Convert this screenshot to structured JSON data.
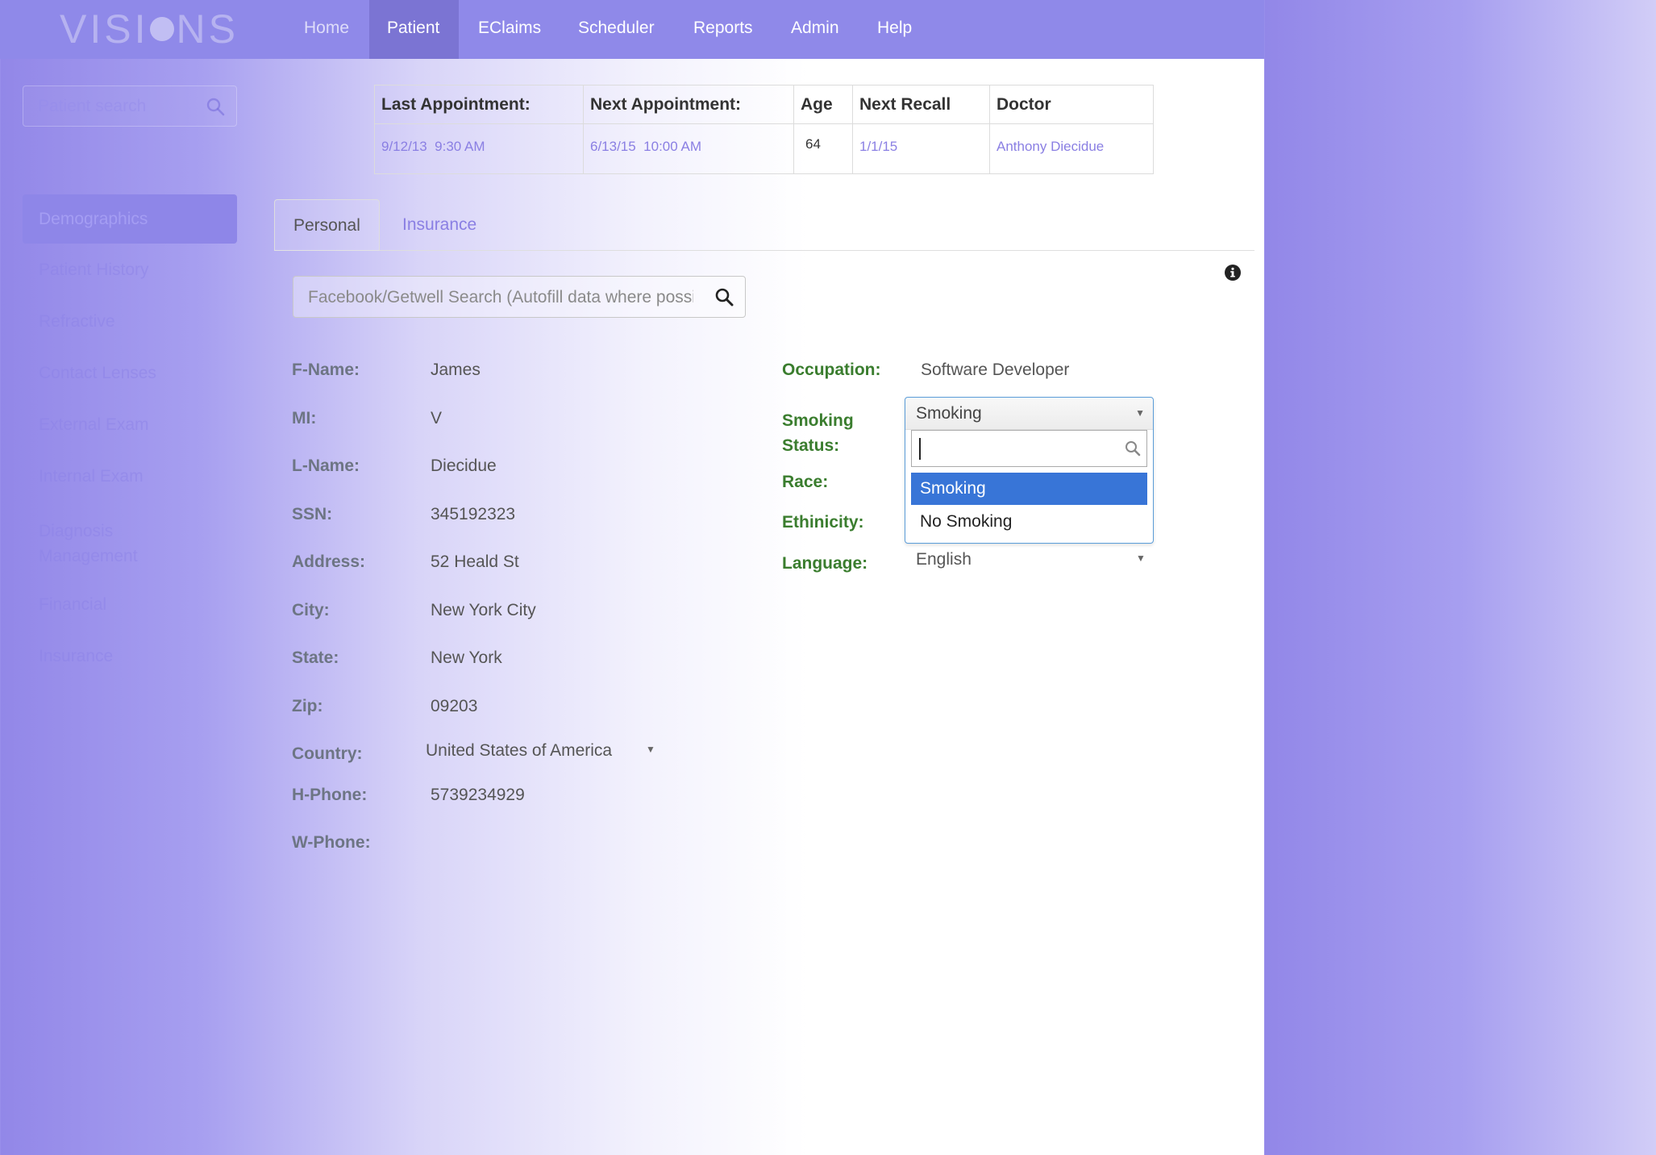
{
  "brand": {
    "logo_left": "VISI",
    "logo_right": "NS"
  },
  "nav": {
    "items": [
      {
        "label": "Home"
      },
      {
        "label": "Patient"
      },
      {
        "label": "EClaims"
      },
      {
        "label": "Scheduler"
      },
      {
        "label": "Reports"
      },
      {
        "label": "Admin"
      },
      {
        "label": "Help"
      }
    ],
    "active": "Patient"
  },
  "sidebar": {
    "search_placeholder": "Patient search",
    "items": [
      {
        "label": "Demographics"
      },
      {
        "label": "Patient History"
      },
      {
        "label": "Refractive"
      },
      {
        "label": "Contact Lenses"
      },
      {
        "label": "External Exam"
      },
      {
        "label": "Internal Exam"
      },
      {
        "label": "Diagnosis Management"
      },
      {
        "label": "Financial"
      },
      {
        "label": "Insurance"
      }
    ],
    "active": "Demographics"
  },
  "appointments": {
    "headers": [
      "Last Appointment:",
      "Next Appointment:",
      "Age",
      "Next Recall",
      "Doctor"
    ],
    "row": [
      "9/12/13  9:30 AM",
      "6/13/15  10:00 AM",
      "64",
      "1/1/15",
      "Anthony Diecidue"
    ]
  },
  "tabs": [
    {
      "label": "Personal",
      "active": true
    },
    {
      "label": "Insurance",
      "active": false
    }
  ],
  "social_search": {
    "placeholder": "Facebook/Getwell Search (Autofill data where possible)"
  },
  "personal": {
    "fname": {
      "label": "F-Name:",
      "value": "James"
    },
    "mi": {
      "label": "MI:",
      "value": "V"
    },
    "lname": {
      "label": "L-Name:",
      "value": "Diecidue"
    },
    "ssn": {
      "label": "SSN:",
      "value": "345192323"
    },
    "address": {
      "label": "Address:",
      "value": "52 Heald St"
    },
    "city": {
      "label": "City:",
      "value": "New York City"
    },
    "state": {
      "label": "State:",
      "value": "New York"
    },
    "zip": {
      "label": "Zip:",
      "value": "09203"
    },
    "country": {
      "label": "Country:",
      "value": "United States of America"
    },
    "hphone": {
      "label": "H-Phone:",
      "value": "5739234929"
    },
    "wphone": {
      "label": "W-Phone:",
      "value": ""
    }
  },
  "profile": {
    "occupation": {
      "label": "Occupation:",
      "value": "Software Developer"
    },
    "smoking": {
      "label_line1": "Smoking",
      "label_line2": "Status:",
      "value": "Smoking",
      "search_value": "",
      "options": [
        "Smoking",
        "No Smoking"
      ],
      "highlighted": "Smoking"
    },
    "race": {
      "label": "Race:"
    },
    "ethnicity": {
      "label": "Ethinicity:"
    },
    "language": {
      "label": "Language:",
      "value": "English"
    }
  },
  "colors": {
    "nav_bg": "#8f89e9",
    "nav_active": "#7b74d3",
    "link": "#8a7fe3",
    "label_green": "#3a7d2e",
    "option_highlight": "#3875d7"
  }
}
